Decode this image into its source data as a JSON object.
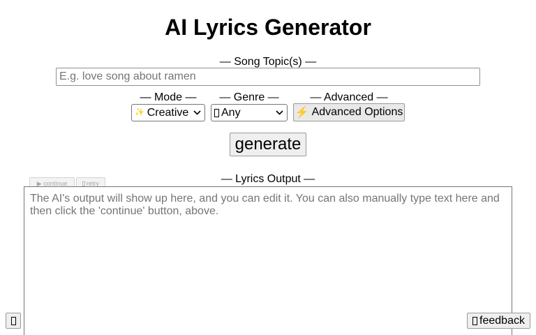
{
  "header": {
    "title": "AI Lyrics Generator"
  },
  "topic": {
    "label": "— Song Topic(s) —",
    "placeholder": "E.g. love song about ramen",
    "value": ""
  },
  "mode": {
    "label": "— Mode —",
    "selected": "Creative",
    "icon": "sparkles-icon"
  },
  "genre": {
    "label": "— Genre —",
    "selected": "Any",
    "icon": "music-note-icon"
  },
  "advanced": {
    "label": "— Advanced —",
    "button_label": "Advanced Options",
    "button_prefix": "⚡",
    "icon": "lightning-icon"
  },
  "generate": {
    "label": "generate"
  },
  "output": {
    "label": "— Lyrics Output —",
    "continue_label": "▶ continue",
    "retry_label": "retry",
    "placeholder": "The AI's output will show up here, and you can edit it. You can also manually type text here and then click the 'continue' button, above.",
    "value": ""
  },
  "footer": {
    "feedback_label": "feedback"
  },
  "colors": {
    "button_bg": "#efefef",
    "border": "#767676",
    "placeholder": "#757575",
    "disabled_text": "#a7a7a7"
  }
}
